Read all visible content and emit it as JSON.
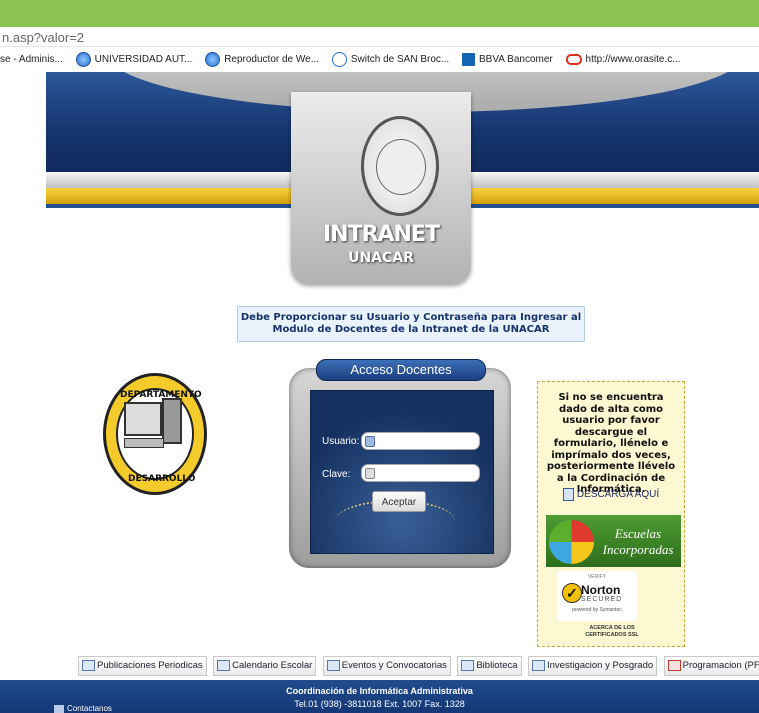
{
  "browser": {
    "url": "n.asp?valor=2",
    "bookmarks": [
      {
        "label": "se - Adminis...",
        "icon": "none"
      },
      {
        "label": "UNIVERSIDAD AUT...",
        "icon": "globe-icon",
        "color": "#2a6fd1"
      },
      {
        "label": "Reproductor de We...",
        "icon": "globe-icon",
        "color": "#2a6fd1"
      },
      {
        "label": "Switch de SAN Broc...",
        "icon": "globe-outline-icon",
        "color": "#2a6fd1"
      },
      {
        "label": "BBVA Bancomer",
        "icon": "bank-icon",
        "color": "#1464b4"
      },
      {
        "label": "http://www.orasite.c...",
        "icon": "oracle-icon",
        "color": "#e0301e"
      }
    ]
  },
  "header": {
    "title": "INTRANET",
    "subtitle": "UNACAR",
    "seal_icon": "university-seal-icon"
  },
  "notice": {
    "line1": "Debe Proporcionar su Usuario y Contraseña para Ingresar al",
    "line2": "Modulo de Docentes de la Intranet de la UNACAR"
  },
  "dept_logo": {
    "top_text": "DEPARTAMENTO",
    "bottom_text": "DESARROLLO"
  },
  "login": {
    "title": "Acceso Docentes",
    "user_label": "Usuario:",
    "user_value": "",
    "password_label": "Clave:",
    "password_value": "",
    "submit_label": "Aceptar"
  },
  "sidebar": {
    "message": "Si no se encuentra dado de alta como usuario por favor descargue el formulario, llénelo e imprímalo dos veces, posteriormente llévelo a la Cordinación de Informática.",
    "download_label": "DESCARGA AQUÍ",
    "escuelas_line1": "Escuelas",
    "escuelas_line2": "Incorporadas",
    "norton_verify": "VERIFY",
    "norton_brand": "Norton",
    "norton_secured": "SECURED",
    "norton_powered": "powered by Symantec",
    "ssl_line1": "ACERCA DE LOS",
    "ssl_line2": "CERTIFICADOS SSL"
  },
  "nav": [
    {
      "label": "Publicaciones Periodicas"
    },
    {
      "label": "Calendario Escolar"
    },
    {
      "label": "Eventos y Convocatorias"
    },
    {
      "label": "Biblioteca"
    },
    {
      "label": "Investigacion y Posgrado"
    },
    {
      "label": "Programacion (PFD)"
    }
  ],
  "footer": {
    "line1": "Coordinación de Informática Administrativa",
    "line2": "Tel.01 (938) -3811018 Ext. 1007 Fax. 1328",
    "contact": "Contactanos"
  },
  "colors": {
    "browser_bar": "#8dc352",
    "brand_blue": "#16356e",
    "gold": "#f3cb2a"
  }
}
